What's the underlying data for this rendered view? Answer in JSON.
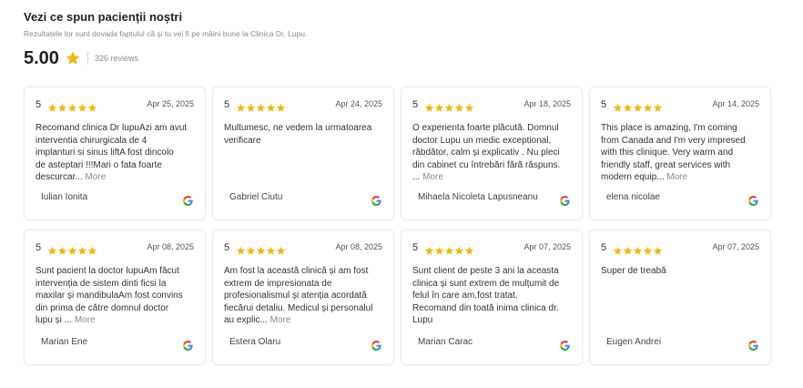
{
  "header": {
    "title": "Vezi ce spun pacienții noștri",
    "subtitle": "Rezultatele lor sunt dovada faptului că și tu vei fi pe mâini bune la Clinica Dr. Lupu.",
    "score": "5.00",
    "review_count": "326 reviews",
    "star_color": "#f5b800"
  },
  "reviews": [
    {
      "rating": "5",
      "stars": 5,
      "date": "Apr 25, 2025",
      "text": "Recomand clinica Dr lupuAzi am avut\ninterventia chirurgicala de 4\nimplanturi si sinus liftA fost dincolo\nde asteptari !!!Mari o fata foarte\ndescurcar... ",
      "more": "More",
      "author": "Iulian Ionita",
      "icon": "google-icon"
    },
    {
      "rating": "5",
      "stars": 5,
      "date": "Apr 24, 2025",
      "text": "Multumesc, ne vedem la urmatoarea\nverificare",
      "more": "",
      "author": "Gabriel Ciutu",
      "icon": "google-icon"
    },
    {
      "rating": "5",
      "stars": 5,
      "date": "Apr 18, 2025",
      "text": "O experienta foarte plăcută. Domnul\ndoctor Lupu un medic exceptional,\nrăbdător, calm și explicativ . Nu pleci\ndin cabinet cu întrebări fără răspuns.\n... ",
      "more": "More",
      "author": "Mihaela Nicoleta Lapusneanu",
      "icon": "google-icon"
    },
    {
      "rating": "5",
      "stars": 5,
      "date": "Apr 14, 2025",
      "text": "This place is amazing, I'm coming\nfrom Canada and I'm very impresed\nwith this clinique. Very warm and\nfriendly staff, great services with\nmodern equip... ",
      "more": "More",
      "author": "elena nicolae",
      "icon": "google-icon"
    },
    {
      "rating": "5",
      "stars": 5,
      "date": "Apr 08, 2025",
      "text": "Sunt pacient la doctor lupuAm făcut\nintervenția de sistem dinti ficsi la\nmaxilar și mandibulaAm fost convins\ndin prima de către domnul doctor\nlupu și ... ",
      "more": "More",
      "author": "Marian Ene",
      "icon": "google-icon"
    },
    {
      "rating": "5",
      "stars": 5,
      "date": "Apr 08, 2025",
      "text": "Am fost la această clinică și am fost\nextrem de impresionata de\nprofesionalismul și atenția acordată\nfiecărui detaliu. Medicul și personalul\nau explic... ",
      "more": "More",
      "author": "Estera Olaru",
      "icon": "google-icon"
    },
    {
      "rating": "5",
      "stars": 5,
      "date": "Apr 07, 2025",
      "text": "Sunt client de peste 3 ani la aceasta\nclinica și sunt extrem de mulțumit de\nfelul în care am,fost tratat.\nRecomand din toată inima clinica dr.\nLupu",
      "more": "",
      "author": "Marian Carac",
      "icon": "google-icon"
    },
    {
      "rating": "5",
      "stars": 5,
      "date": "Apr 07, 2025",
      "text": "Super de treabă",
      "more": "",
      "author": "Eugen Andrei",
      "icon": "google-icon"
    }
  ]
}
